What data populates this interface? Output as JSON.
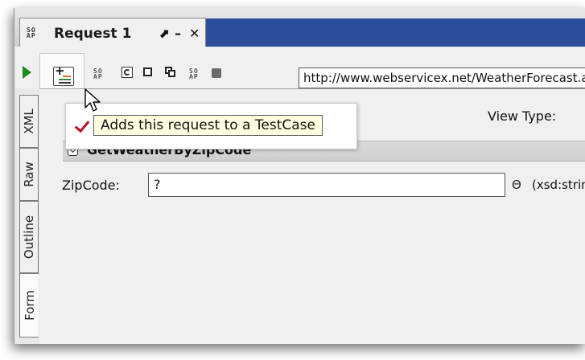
{
  "tab": {
    "soap_icon_top": "SO",
    "soap_icon_bottom": "AP",
    "title": "Request 1",
    "pin_glyph": "⬈",
    "min_glyph": "–",
    "close_glyph": "✕"
  },
  "toolbar": {
    "run_icon": "play-icon",
    "add_to_testcase_icon": "add-to-testcase-icon",
    "soap_icon_top": "SO",
    "soap_icon_bottom": "AP",
    "url": "http://www.webservicex.net/WeatherForecast.asmx"
  },
  "tooltip": {
    "text": "Adds this request to a TestCase"
  },
  "side_tabs": [
    "XML",
    "Raw",
    "Outline",
    "Form"
  ],
  "view_type_label": "View Type:",
  "operation": {
    "name": "GetWeatherByZipCode"
  },
  "field": {
    "label": "ZipCode:",
    "value": "?",
    "clear_glyph": "Θ",
    "type": "(xsd:string)"
  },
  "colors": {
    "title_blue": "#2d4e9c",
    "run_green": "#1a8a1a",
    "check_red": "#b8102b",
    "tooltip_bg": "#ffffe1"
  }
}
